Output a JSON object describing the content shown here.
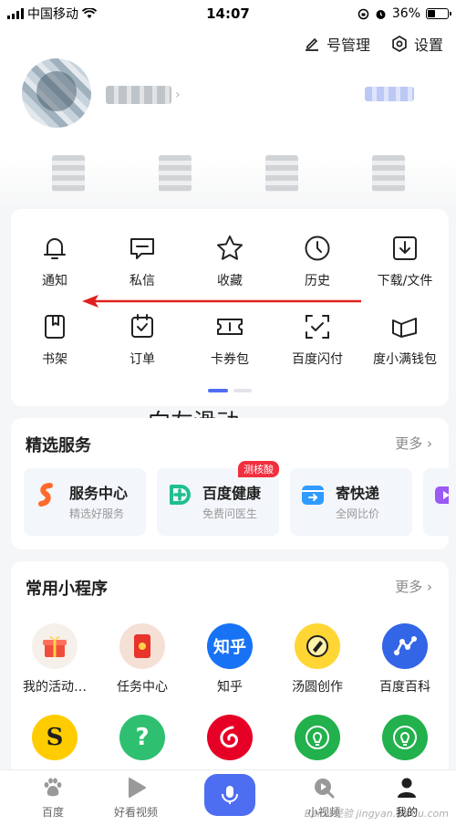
{
  "status_bar": {
    "carrier": "中国移动",
    "time": "14:07",
    "battery": "36%",
    "battery_level": 0.36
  },
  "top_actions": [
    {
      "label": "号管理",
      "icon": "edit-icon"
    },
    {
      "label": "设置",
      "icon": "gear-icon"
    }
  ],
  "tools": [
    {
      "label": "通知",
      "icon": "bell-icon"
    },
    {
      "label": "私信",
      "icon": "message-icon"
    },
    {
      "label": "收藏",
      "icon": "star-icon"
    },
    {
      "label": "历史",
      "icon": "clock-icon"
    },
    {
      "label": "下载/文件",
      "icon": "download-icon"
    },
    {
      "label": "书架",
      "icon": "bookshelf-icon"
    },
    {
      "label": "订单",
      "icon": "order-icon"
    },
    {
      "label": "卡券包",
      "icon": "ticket-icon"
    },
    {
      "label": "百度闪付",
      "icon": "scan-pay-icon"
    },
    {
      "label": "度小满钱包",
      "icon": "wallet-icon"
    }
  ],
  "annotation": {
    "hint": "向左滑动"
  },
  "services": {
    "title": "精选服务",
    "more": "更多",
    "items": [
      {
        "title": "服务中心",
        "subtitle": "精选好服务",
        "color": "#ff6a2b"
      },
      {
        "title": "百度健康",
        "subtitle": "免费问医生",
        "tag": "测核酸",
        "color": "#1fbf8f"
      },
      {
        "title": "寄快递",
        "subtitle": "全网比价",
        "color": "#2f9bff"
      },
      {
        "title": "",
        "subtitle": "",
        "color": "#9b59f5"
      }
    ]
  },
  "apps": {
    "title": "常用小程序",
    "more": "更多",
    "items": [
      {
        "label": "我的活动…",
        "icon": "gift-icon",
        "color": "#f5f0ea"
      },
      {
        "label": "任务中心",
        "icon": "task-icon",
        "color": "#f5e0d6"
      },
      {
        "label": "知乎",
        "icon": "zhihu-icon",
        "color": "#1772f6",
        "glyph": "知乎"
      },
      {
        "label": "汤圆创作",
        "icon": "tangyuan-icon",
        "color": "#ffd633"
      },
      {
        "label": "百度百科",
        "icon": "baike-icon",
        "color": "#3366e6"
      },
      {
        "label": "",
        "icon": "s-logo-icon",
        "color": "#ffcc00",
        "glyph": "S"
      },
      {
        "label": "",
        "icon": "question-icon",
        "color": "#2fbf71",
        "glyph": "?"
      },
      {
        "label": "",
        "icon": "netease-music-icon",
        "color": "#e60026"
      },
      {
        "label": "",
        "icon": "bulb-icon",
        "color": "#22b14c"
      },
      {
        "label": "",
        "icon": "bulb-icon",
        "color": "#22b14c"
      }
    ]
  },
  "bottom_nav": [
    {
      "label": "百度",
      "icon": "paw-icon"
    },
    {
      "label": "好看视频",
      "icon": "play-icon"
    },
    {
      "label": "",
      "icon": "microphone-icon"
    },
    {
      "label": "小视频",
      "icon": "small-video-icon"
    },
    {
      "label": "我的",
      "icon": "profile-icon"
    }
  ],
  "watermark": "Baidu经验 jingyan.baidu.com"
}
